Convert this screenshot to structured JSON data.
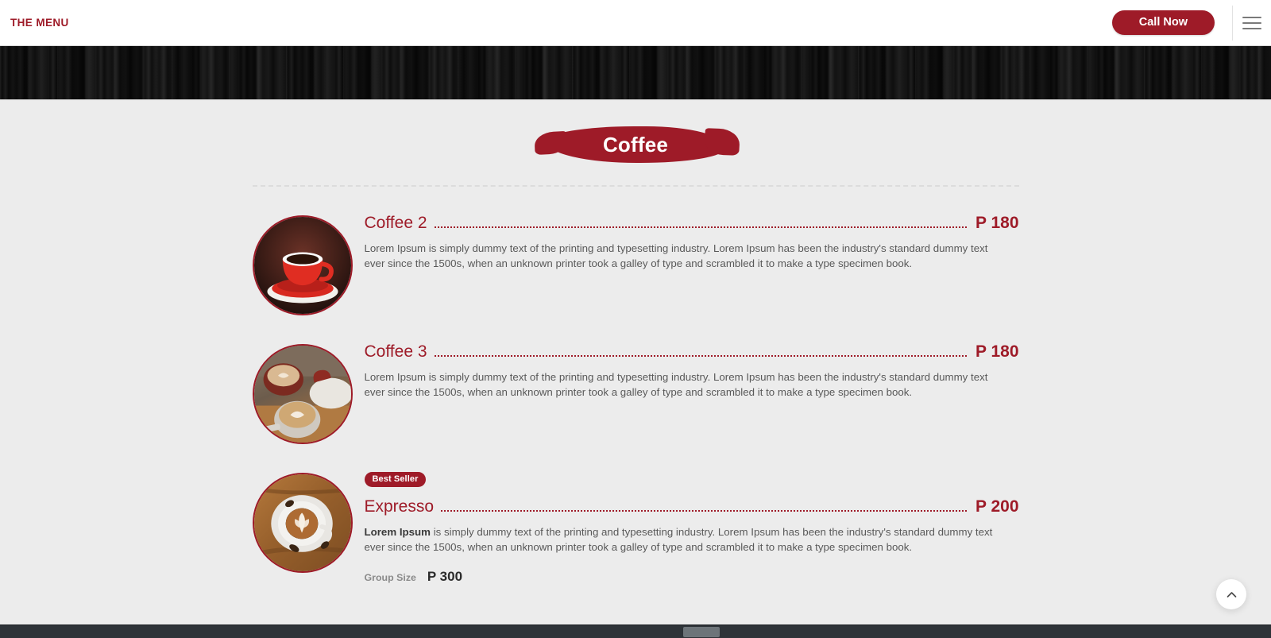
{
  "header": {
    "brand": "THE MENU",
    "call_now_label": "Call Now",
    "menu_icon": "hamburger-icon",
    "accent_color": "#9e1b28"
  },
  "section": {
    "title": "Coffee"
  },
  "menu_items": [
    {
      "image": "coffee-cup-red-saucer",
      "badge": "",
      "title": "Coffee 2",
      "price": "P 180",
      "desc_lead": "",
      "desc": "Lorem Ipsum is simply dummy text of the printing and typesetting industry. Lorem Ipsum has been the industry's standard dummy text ever since the 1500s, when an unknown printer took a galley of type and scrambled it to make a type specimen book.",
      "extra_label": "",
      "extra_price": ""
    },
    {
      "image": "cappuccino-cups-table",
      "badge": "",
      "title": "Coffee 3",
      "price": "P 180",
      "desc_lead": "",
      "desc": "Lorem Ipsum is simply dummy text of the printing and typesetting industry. Lorem Ipsum has been the industry's standard dummy text ever since the 1500s, when an unknown printer took a galley of type and scrambled it to make a type specimen book.",
      "extra_label": "",
      "extra_price": ""
    },
    {
      "image": "latte-art-wood-table",
      "badge": "Best Seller",
      "title": "Expresso",
      "price": "P 200",
      "desc_lead": "Lorem Ipsum",
      "desc": " is simply dummy text of the printing and typesetting industry. Lorem Ipsum has been the industry's standard dummy text ever since the 1500s, when an unknown printer took a galley of type and scrambled it to make a type specimen book.",
      "extra_label": "Group Size",
      "extra_price": "P 300"
    }
  ],
  "scroll_top": {
    "icon": "chevron-up-icon"
  }
}
